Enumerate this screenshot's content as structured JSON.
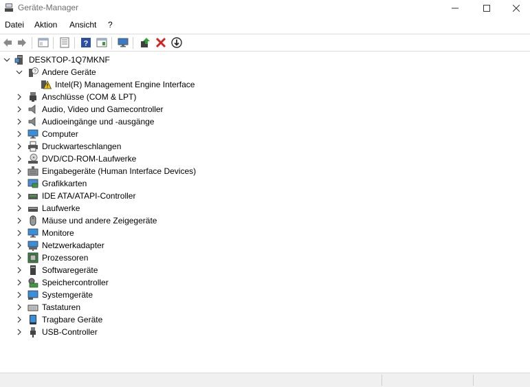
{
  "window": {
    "title": "Geräte-Manager"
  },
  "menu": [
    "Datei",
    "Aktion",
    "Ansicht",
    "?"
  ],
  "tree": {
    "root": "DESKTOP-1Q7MKNF",
    "other_devices": {
      "label": "Andere Geräte",
      "child": "Intel(R) Management Engine Interface"
    },
    "categories": [
      "Anschlüsse (COM & LPT)",
      "Audio, Video und Gamecontroller",
      "Audioeingänge und -ausgänge",
      "Computer",
      "Druckwarteschlangen",
      "DVD/CD-ROM-Laufwerke",
      "Eingabegeräte (Human Interface Devices)",
      "Grafikkarten",
      "IDE ATA/ATAPI-Controller",
      "Laufwerke",
      "Mäuse und andere Zeigegeräte",
      "Monitore",
      "Netzwerkadapter",
      "Prozessoren",
      "Softwaregeräte",
      "Speichercontroller",
      "Systemgeräte",
      "Tastaturen",
      "Tragbare Geräte",
      "USB-Controller"
    ]
  }
}
